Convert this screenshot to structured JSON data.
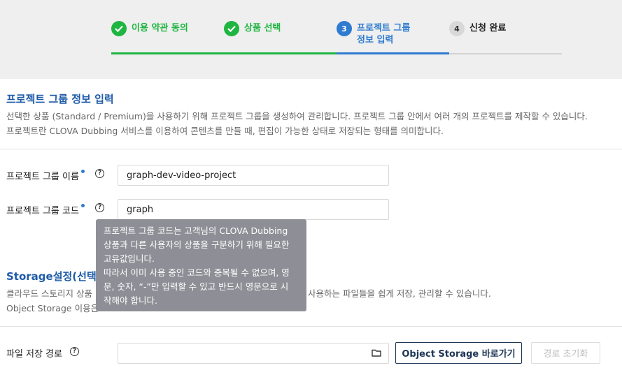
{
  "stepper": {
    "steps": [
      {
        "number": "",
        "label_line1": "이용 약관 동의",
        "label_line2": "",
        "status": "done"
      },
      {
        "number": "",
        "label_line1": "상품 선택",
        "label_line2": "",
        "status": "done"
      },
      {
        "number": "3",
        "label_line1": "프로젝트 그룹",
        "label_line2": "정보 입력",
        "status": "current"
      },
      {
        "number": "4",
        "label_line1": "신청 완료",
        "label_line2": "",
        "status": "pending"
      }
    ]
  },
  "project_section": {
    "title": "프로젝트 그룹 정보 입력",
    "desc1": "선택한 상품 (Standard / Premium)을 사용하기 위해 프로젝트 그룹을 생성하여 관리합니다. 프로젝트 그룹 안에서 여러 개의 프로젝트를 제작할 수 있습니다.",
    "desc2": "프로젝트란 CLOVA Dubbing 서비스를 이용하여 콘텐츠를 만들 때, 편집이 가능한 상태로 저장되는 형태를 의미합니다."
  },
  "form": {
    "name_label": "프로젝트 그룹 이름",
    "name_value": "graph-dev-video-project",
    "code_label": "프로젝트 그룹 코드",
    "code_value": "graph"
  },
  "tooltip": {
    "line1": "프로젝트 그룹 코드는 고객님의 CLOVA Dubbing",
    "line2": "상품과 다른 사용자의 상품을 구분하기 위해 필요한",
    "line3": "고유값입니다.",
    "line4": "따라서 이미 사용 중인 코드와 중복될 수 없으며, 영",
    "line5": "문, 숫자, “-”만 입력할 수 있고 반드시 영문으로 시",
    "line6": "작해야 합니다."
  },
  "storage_section": {
    "title": "Storage설정(선택)",
    "desc1_left": "클라우드 스토리지 상품",
    "desc1_right": "사용하는 파일들을 쉽게 저장, 관리할 수 있습니다.",
    "desc2_left": "Object Storage 이용은"
  },
  "path": {
    "label": "파일 저장 경로",
    "value": "",
    "goto_button": "Object Storage 바로가기",
    "reset_button": "경로 초기화"
  },
  "colors": {
    "done": "#1fb541",
    "current": "#2e7bd0",
    "title": "#1e5ba8",
    "tooltip_bg": "#8e8f96"
  }
}
